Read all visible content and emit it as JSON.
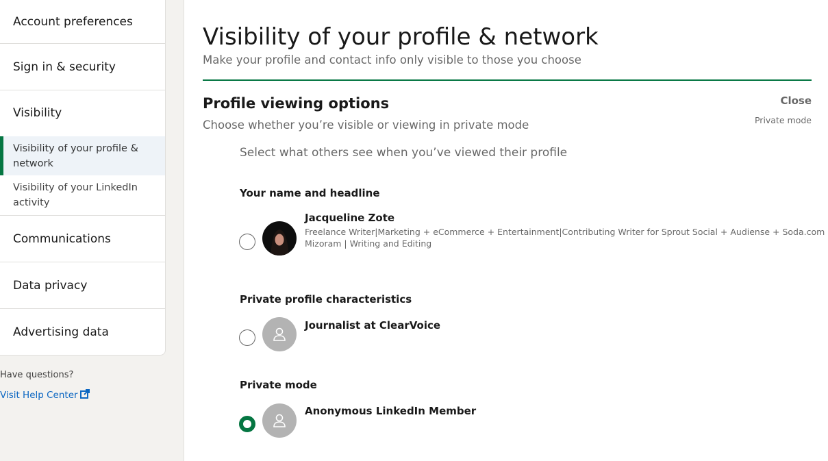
{
  "sidebar": {
    "items": [
      {
        "label": "Account preferences"
      },
      {
        "label": "Sign in & security"
      },
      {
        "label": "Visibility"
      },
      {
        "label": "Communications"
      },
      {
        "label": "Data privacy"
      },
      {
        "label": "Advertising data"
      }
    ],
    "sub_items": [
      {
        "label": "Visibility of your profile & network",
        "active": true
      },
      {
        "label": "Visibility of your LinkedIn activity",
        "active": false
      }
    ],
    "help_question": "Have questions?",
    "help_link": "Visit Help Center"
  },
  "main": {
    "title": "Visibility of your profile & network",
    "subtitle": "Make your profile and contact info only visible to those you choose",
    "section": {
      "title": "Profile viewing options",
      "description": "Choose whether you’re visible or viewing in private mode",
      "close_label": "Close",
      "current_setting": "Private mode",
      "prompt": "Select what others see when you’ve viewed their profile"
    },
    "options": [
      {
        "label": "Your name and headline",
        "name": "Jacqueline Zote",
        "headline_line1": "Freelance Writer|Marketing + eCommerce + Entertainment|Contributing Writer for Sprout Social + Audiense + Soda.com",
        "headline_line2": "Mizoram | Writing and Editing",
        "selected": false
      },
      {
        "label": "Private profile characteristics",
        "name": "Journalist at ClearVoice",
        "selected": false
      },
      {
        "label": "Private mode",
        "name": "Anonymous LinkedIn Member",
        "selected": true
      }
    ]
  },
  "colors": {
    "accent": "#057642",
    "link": "#0a66c2",
    "sidebar_bg": "#f3f2ef",
    "active_bg": "#eef3f8"
  },
  "icons": [
    "external-link-icon",
    "person-placeholder-icon"
  ]
}
